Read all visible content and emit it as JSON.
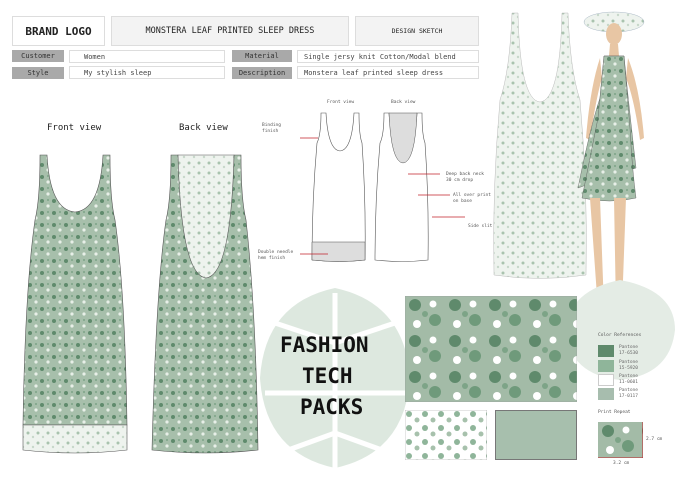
{
  "header": {
    "brand": "BRAND LOGO",
    "title": "MONSTERA LEAF PRINTED SLEEP DRESS",
    "sketch": "DESIGN SKETCH"
  },
  "info": {
    "customer_label": "Customer",
    "customer": "Women",
    "style_label": "Style",
    "style": "My stylish sleep",
    "material_label": "Material",
    "material": "Single jersy knit Cotton/Modal blend",
    "description_label": "Description",
    "description": "Monstera leaf printed sleep dress"
  },
  "views": {
    "front": "Front view",
    "back": "Back view",
    "flat_front": "Front view",
    "flat_back": "Back view"
  },
  "callouts": {
    "binding": "Binding finish",
    "hem": "Double needle hem finish",
    "back_neck": "Deep back neck 30 cm drop",
    "print": "All over print on base",
    "slit": "Side slit hem"
  },
  "logo_text": [
    "FASHION",
    "TECH",
    "PACKS"
  ],
  "colors": {
    "title": "Color References",
    "items": [
      {
        "name": "Pantone 17-6530",
        "hex": "#5f8a6c"
      },
      {
        "name": "Pantone 15-5920",
        "hex": "#8fb59a"
      },
      {
        "name": "Pantone 11-0601",
        "hex": "#ffffff"
      },
      {
        "name": "Pantone 17-0117",
        "hex": "#a7bdae"
      }
    ]
  },
  "repeat": {
    "title": "Print Repeat",
    "height": "2.7 cm",
    "width": "3.2 cm"
  },
  "accent": "#c0202a",
  "fabric": "#9fb8a5"
}
